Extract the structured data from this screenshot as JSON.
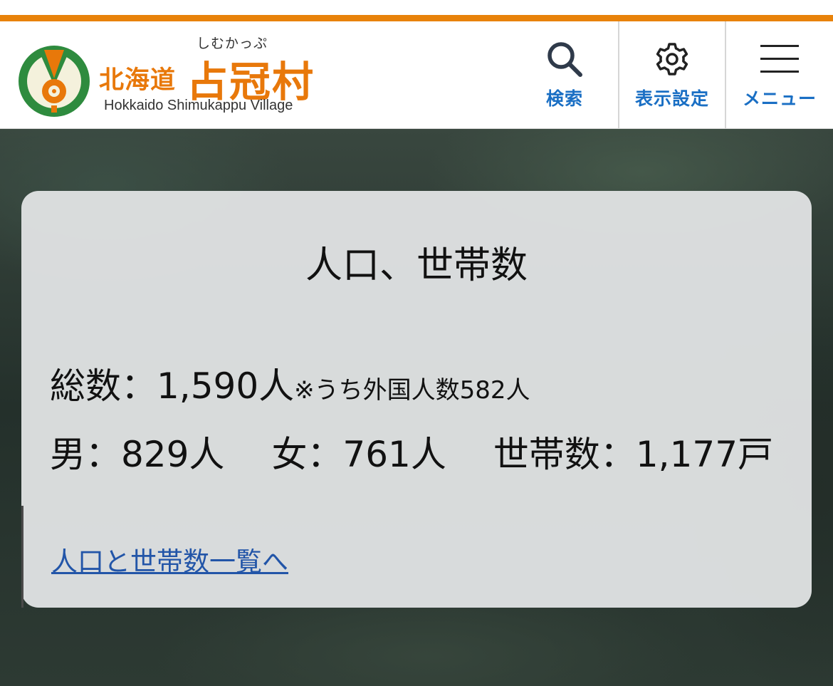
{
  "header": {
    "logo": {
      "prefecture": "北海道",
      "ruby": "しむかっぷ",
      "village": "占冠村",
      "english": "Hokkaido Shimukappu Village"
    },
    "nav": [
      {
        "label": "検索",
        "icon": "search-icon"
      },
      {
        "label": "表示設定",
        "icon": "gear-icon"
      },
      {
        "label": "メニュー",
        "icon": "hamburger-icon"
      }
    ]
  },
  "colors": {
    "accent": "#e8820a",
    "nav_text": "#1a6fc4",
    "link": "#2255a8"
  },
  "population": {
    "title": "人口、世帯数",
    "total_label": "総数：1,590人",
    "foreign_note": "※うち外国人数582人",
    "male": "男：829人",
    "female": "女：761人",
    "households": "世帯数：1,177戸",
    "link_label": "人口と世帯数一覧へ"
  }
}
